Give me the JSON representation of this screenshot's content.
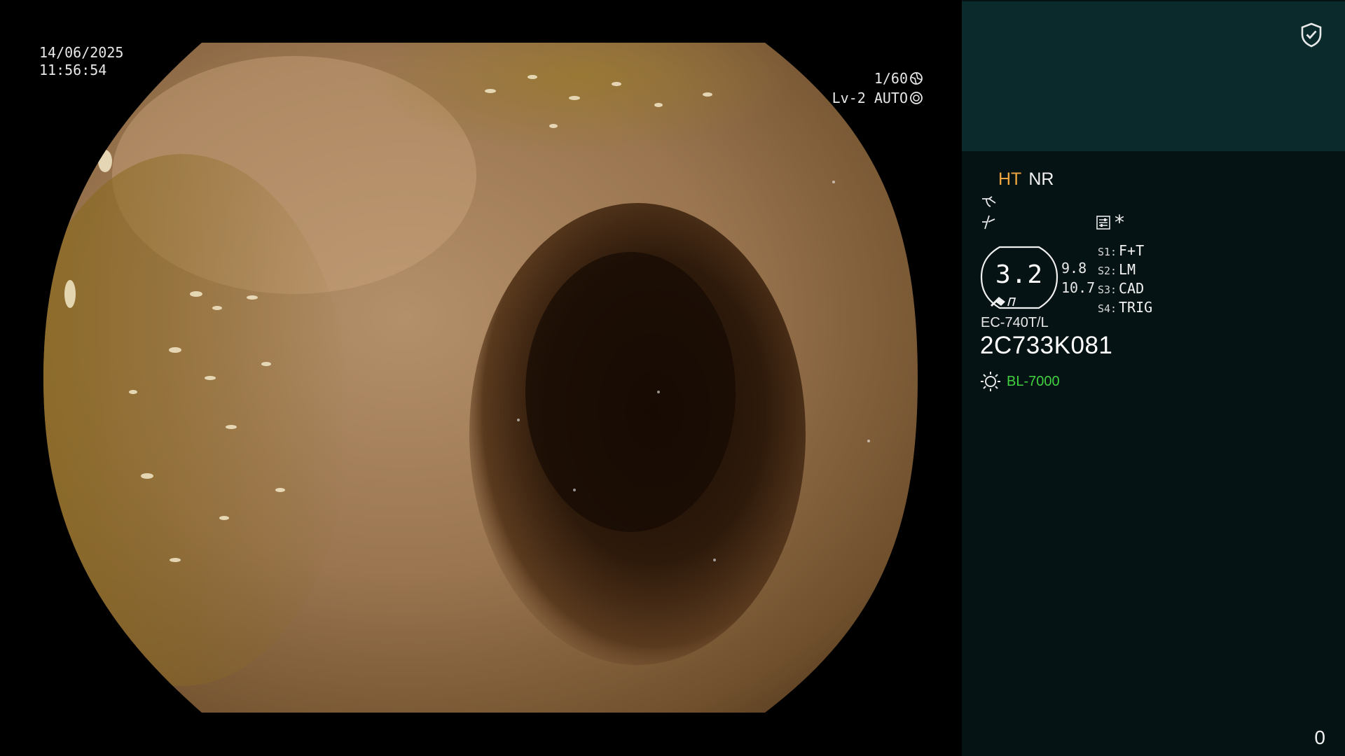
{
  "overlay": {
    "date": "14/06/2025",
    "time": "11:56:54",
    "shutter": "1/60",
    "level_mode": "Lv-2 AUTO"
  },
  "panel": {
    "enhancement": {
      "ht": "HT",
      "nr": "NR"
    },
    "zoom": {
      "value": "3.2",
      "sub_top": "9.8",
      "sub_bottom": "10.7"
    },
    "switches": [
      {
        "key": "S1:",
        "value": "F+T"
      },
      {
        "key": "S2:",
        "value": "LM"
      },
      {
        "key": "S3:",
        "value": "CAD"
      },
      {
        "key": "S4:",
        "value": "TRIG"
      }
    ],
    "asterisk": "*",
    "scope_model": "EC-740T/L",
    "scope_serial": "2C733K081",
    "light_source": "BL-7000",
    "counter": "0"
  },
  "colors": {
    "panel_bg": "#061314",
    "panel_header_bg": "#0b2a2c",
    "ht_label": "#f0a640",
    "light_source_label": "#3fd13f"
  },
  "icons": [
    "shield-check-icon",
    "shutter-icon",
    "iris-icon",
    "contrast-icon",
    "edge-enhance-icon",
    "preset-icon",
    "light-source-icon"
  ]
}
